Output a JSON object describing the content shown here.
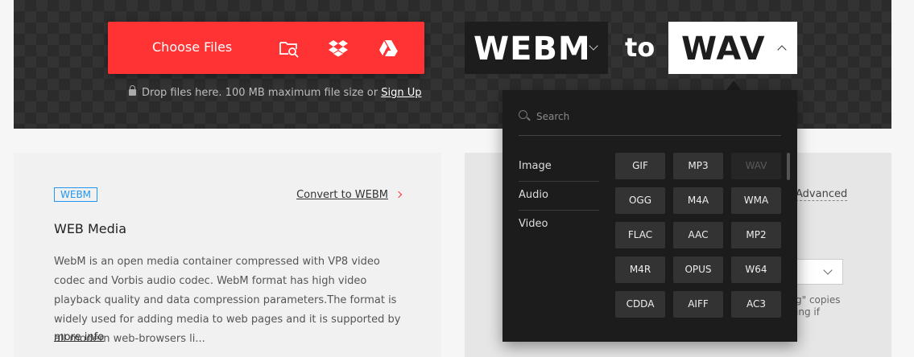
{
  "upload": {
    "choose_label": "Choose Files",
    "icons": [
      "folder-search-icon",
      "dropbox-icon",
      "google-drive-icon"
    ],
    "drop_text": "Drop files here. 100 MB maximum file size or",
    "signup_label": "Sign Up",
    "accent": "#ff3333"
  },
  "converter": {
    "from_format": "WEBM",
    "to_text": "to",
    "to_format": "WAV"
  },
  "dropdown": {
    "search_placeholder": "Search",
    "categories": [
      "Image",
      "Audio",
      "Video"
    ],
    "formats": [
      "GIF",
      "MP3",
      "WAV",
      "OGG",
      "M4A",
      "WMA",
      "FLAC",
      "AAC",
      "MP2",
      "M4R",
      "OPUS",
      "W64",
      "CDDA",
      "AIFF",
      "AC3"
    ],
    "current_format": "WAV"
  },
  "info_card": {
    "badge": "WEBM",
    "convert_link": "Convert to WEBM",
    "title": "WEB Media",
    "description": "WebM is an open media container compressed with VP8 video codec and Vorbis audio codec. WebM format has high video playback quality and data compression parameters.The format is widely used for adding media to web pages and it is supported by all modern web-browsers li...",
    "more_info": "more info"
  },
  "options_card": {
    "advanced_label": "Advanced",
    "fragment_1": "g\" copies",
    "fragment_2": "ing if"
  }
}
